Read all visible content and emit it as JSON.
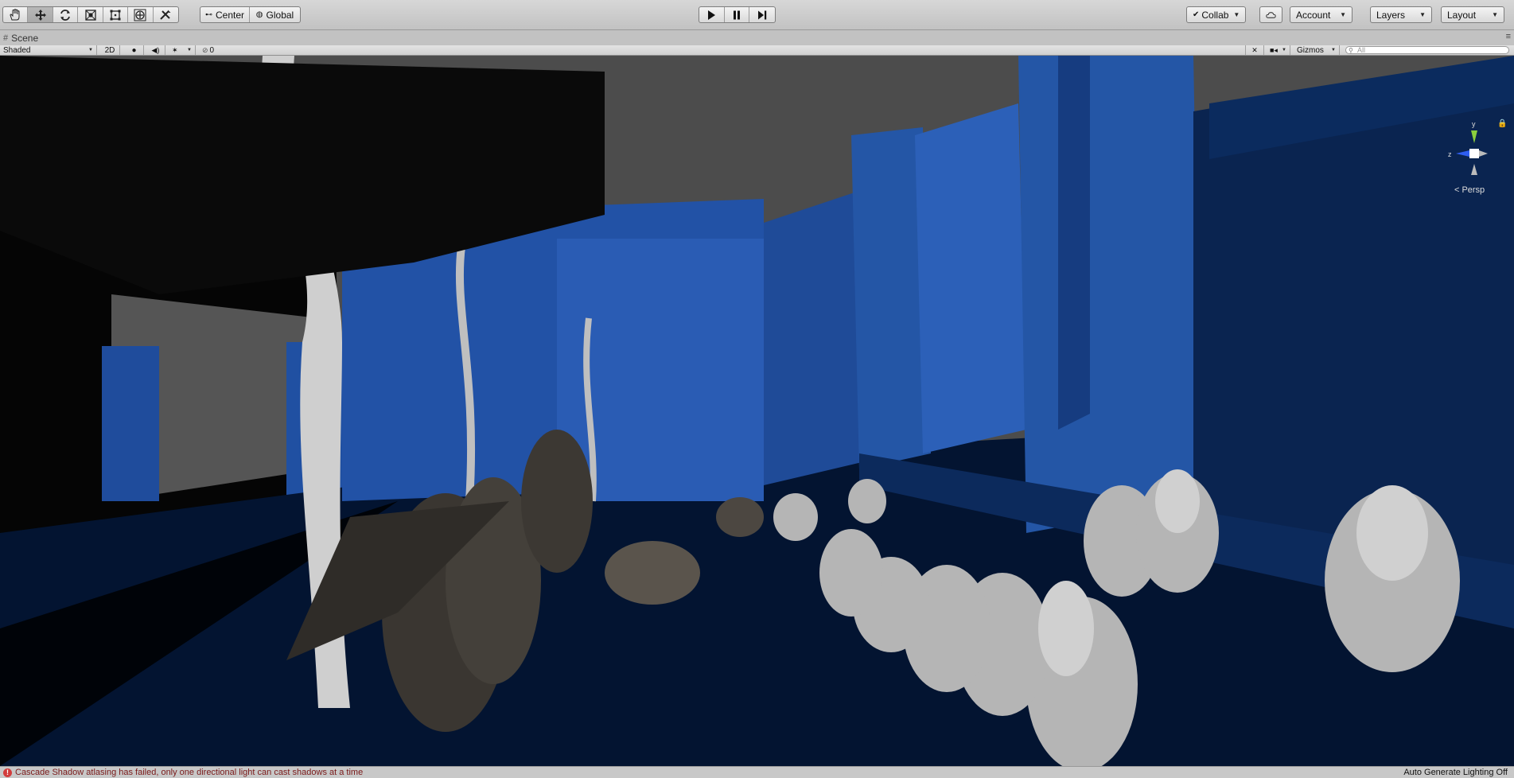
{
  "toolbar": {
    "tools": [
      {
        "name": "hand-tool-icon",
        "active": false
      },
      {
        "name": "move-tool-icon",
        "active": true
      },
      {
        "name": "rotate-tool-icon",
        "active": false
      },
      {
        "name": "scale-tool-icon",
        "active": false
      },
      {
        "name": "rect-tool-icon",
        "active": false
      },
      {
        "name": "transform-tool-icon",
        "active": false
      },
      {
        "name": "custom-tool-icon",
        "active": false
      }
    ],
    "pivot_center": "Center",
    "pivot_global": "Global",
    "collab": "Collab",
    "account": "Account",
    "layers": "Layers",
    "layout": "Layout"
  },
  "scene_tab": {
    "label": "Scene"
  },
  "scene_bar": {
    "draw_mode": "Shaded",
    "mode_2d": "2D",
    "hidden_count": "0",
    "gizmos": "Gizmos",
    "search_placeholder": "All"
  },
  "viewport": {
    "gizmo_y": "y",
    "gizmo_z": "z",
    "projection": "Persp"
  },
  "status": {
    "message": "Cascade Shadow atlasing has failed, only one directional light can cast shadows at a time",
    "lighting": "Auto Generate Lighting Off"
  },
  "colors": {
    "scene_blue": "#2456a6",
    "scene_floor": "#041633",
    "error_red": "#d23c3c"
  }
}
